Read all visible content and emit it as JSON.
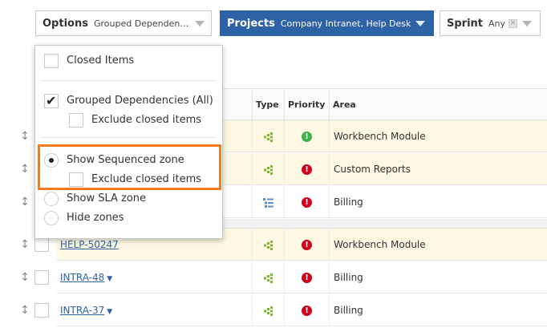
{
  "filters": {
    "options": {
      "label": "Options",
      "value": "Grouped Dependencies (All)"
    },
    "projects": {
      "label": "Projects",
      "value": "Company Intranet, Help Desk"
    },
    "sprint": {
      "label": "Sprint",
      "value": "Any"
    }
  },
  "options_menu": {
    "closed_items": "Closed Items",
    "grouped_dependencies": "Grouped Dependencies (All)",
    "exclude_closed_1": "Exclude closed items",
    "show_sequenced": "Show Sequenced zone",
    "exclude_closed_2": "Exclude closed items",
    "show_sla": "Show SLA zone",
    "hide_zones": "Hide zones"
  },
  "table": {
    "headers": {
      "type": "Type",
      "priority": "Priority",
      "area": "Area"
    },
    "rows": [
      {
        "key": "",
        "type": "dependency",
        "priority": "low",
        "area": "Workbench Module",
        "zone": "sequenced"
      },
      {
        "key": "",
        "type": "dependency",
        "priority": "high",
        "area": "Custom Reports",
        "zone": "sequenced"
      },
      {
        "key": "",
        "type": "list",
        "priority": "high",
        "area": "Billing",
        "zone": "none"
      },
      {
        "key": "HELP-50247",
        "type": "dependency",
        "priority": "high",
        "area": "Workbench Module",
        "zone": "sequenced"
      },
      {
        "key": "INTRA-48",
        "type": "dependency",
        "priority": "high",
        "area": "Billing",
        "zone": "none"
      },
      {
        "key": "INTRA-37",
        "type": "dependency",
        "priority": "high",
        "area": "Billing",
        "zone": "none"
      }
    ]
  },
  "colors": {
    "projects_bg": "#2d63a6",
    "highlight": "#f37b20",
    "sequenced_row": "#fcf8e3",
    "priority_low": "#3bb54a",
    "priority_high": "#d0021b"
  }
}
